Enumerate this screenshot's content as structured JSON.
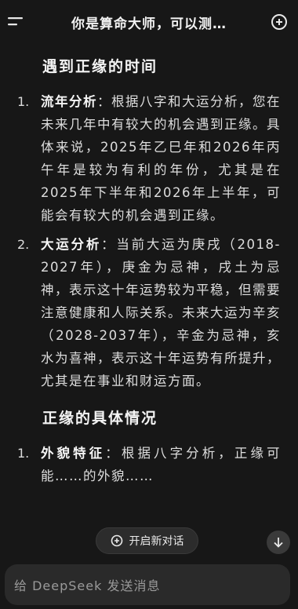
{
  "header": {
    "title": "你是算命大师，可以测…"
  },
  "content": {
    "section1_title": "遇到正缘的时间",
    "items": [
      {
        "num": "1.",
        "bold": "流年分析",
        "text": "：根据八字和大运分析，您在未来几年中有较大的机会遇到正缘。具体来说，2025年乙巳年和2026年丙午年是较为有利的年份，尤其是在2025年下半年和2026年上半年，可能会有较大的机会遇到正缘。"
      },
      {
        "num": "2.",
        "bold": "大运分析",
        "text": "：当前大运为庚戌（2018-2027年），庚金为忌神，戌土为忌神，表示这十年运势较为平稳，但需要注意健康和人际关系。未来大运为辛亥（2028-2037年），辛金为忌神，亥水为喜神，表示这十年运势有所提升，尤其是在事业和财运方面。"
      }
    ],
    "section2_title": "正缘的具体情况",
    "items2": [
      {
        "num": "1.",
        "bold": "外貌特征",
        "text": "：根据八字分析，正缘可能……的外貌……"
      }
    ]
  },
  "new_chat_label": "开启新对话",
  "input_placeholder": "给 DeepSeek 发送消息"
}
